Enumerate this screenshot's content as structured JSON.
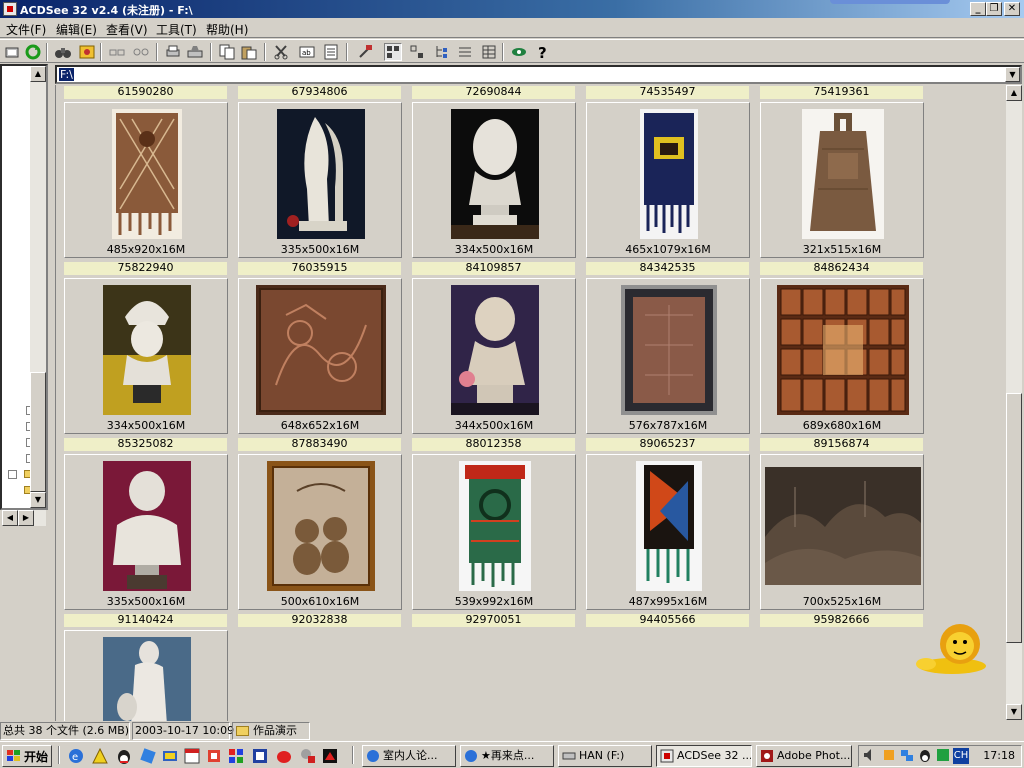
{
  "window": {
    "title": "ACDSee 32 v2.4 (未注册) - F:\\",
    "minimize_glyph": "_",
    "restore_glyph": "❐",
    "close_glyph": "✕"
  },
  "menu": [
    "文件(F)",
    "编辑(E)",
    "查看(V)",
    "工具(T)",
    "帮助(H)"
  ],
  "address": {
    "value": "F:\\"
  },
  "top_strip_names": [
    "61590280",
    "67934806",
    "72690844",
    "74535497",
    "75419361"
  ],
  "rows": [
    {
      "cells": [
        {
          "dims": "485x920x16M",
          "art": "tapestry",
          "name": "75822940"
        },
        {
          "dims": "335x500x16M",
          "art": "sculpture-faces",
          "name": "76035915"
        },
        {
          "dims": "334x500x16M",
          "art": "bust-voltaire",
          "name": "84109857"
        },
        {
          "dims": "465x1079x16M",
          "art": "hanging-blue",
          "name": "84342535"
        },
        {
          "dims": "321x515x16M",
          "art": "bell",
          "name": "84862434"
        }
      ]
    },
    {
      "cells": [
        {
          "dims": "334x500x16M",
          "art": "bust-helmet",
          "name": "85325082"
        },
        {
          "dims": "648x652x16M",
          "art": "copper-relief",
          "name": "87883490"
        },
        {
          "dims": "344x500x16M",
          "art": "bust-woman",
          "name": "88012358"
        },
        {
          "dims": "576x787x16M",
          "art": "framed-copper",
          "name": "89065237"
        },
        {
          "dims": "689x680x16M",
          "art": "wall-panels",
          "name": "89156874"
        }
      ]
    },
    {
      "cells": [
        {
          "dims": "335x500x16M",
          "art": "bust-apollo",
          "name": "91140424"
        },
        {
          "dims": "500x610x16M",
          "art": "framed-figures",
          "name": "92032838"
        },
        {
          "dims": "539x992x16M",
          "art": "hanging-green",
          "name": "92970051"
        },
        {
          "dims": "487x995x16M",
          "art": "hanging-dark",
          "name": "94405566"
        },
        {
          "dims": "700x525x16M",
          "art": "landscape-relief",
          "name": "95982666"
        }
      ]
    },
    {
      "cells": [
        {
          "dims": "",
          "art": "statue-torso",
          "name": ""
        }
      ]
    }
  ],
  "status": {
    "summary": "总共 38 个文件 (2.6 MB)",
    "date": "2003-10-17 10:09",
    "folder": "作品演示"
  },
  "taskbar": {
    "start_label": "开始",
    "tasks": [
      {
        "label": "室内人论...",
        "icon": "ie-icon"
      },
      {
        "label": "★再来点...",
        "icon": "ie-icon"
      },
      {
        "label": "HAN (F:)",
        "icon": "drive-icon"
      },
      {
        "label": "ACDSee 32 ...",
        "icon": "acdsee-icon",
        "active": true
      },
      {
        "label": "Adobe Phot...",
        "icon": "photoshop-icon"
      }
    ],
    "tray_lang": "CH",
    "clock": "17:18"
  }
}
